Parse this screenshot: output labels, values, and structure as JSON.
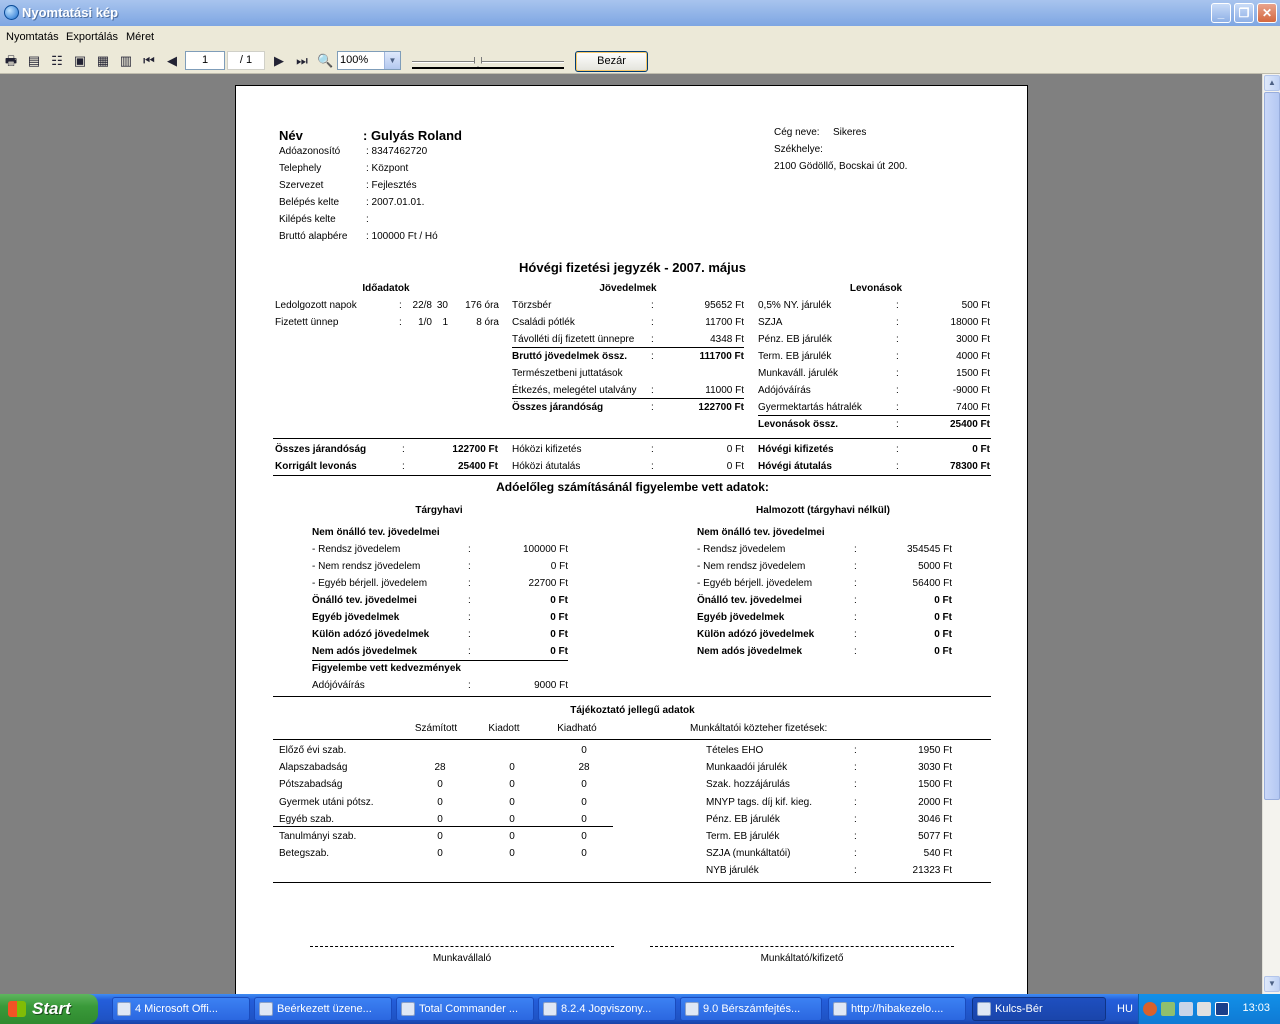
{
  "window": {
    "title": "Nyomtatási kép"
  },
  "menu": [
    "Nyomtatás",
    "Exportálás",
    "Méret"
  ],
  "toolbar": {
    "page_current": "1",
    "page_total": "/ 1",
    "zoom": "100%",
    "close_label": "Bezár"
  },
  "report": {
    "employee": {
      "name_label": "Név",
      "name_value": ": Gulyás Roland",
      "fields": [
        {
          "label": "Adóazonosító",
          "value": ": 8347462720"
        },
        {
          "label": "Telephely",
          "value": ": Központ"
        },
        {
          "label": "Szervezet",
          "value": ": Fejlesztés"
        },
        {
          "label": "Belépés kelte",
          "value": ": 2007.01.01."
        },
        {
          "label": "Kilépés kelte",
          "value": ":"
        },
        {
          "label": "Bruttó alapbére",
          "value": ": 100000  Ft / Hó"
        }
      ]
    },
    "company": {
      "name_label": "Cég neve:",
      "name_value": "Sikeres",
      "seat_label": "Székhelye:",
      "address": "2100  Gödöllő, Bocskai út 200."
    },
    "title": "Hóvégi fizetési jegyzék - 2007. május",
    "time_data": {
      "header": "Időadatok",
      "rows": [
        {
          "label": "Ledolgozott napok",
          "colon": ":",
          "a": "22/8",
          "b": "30",
          "c": "176 óra"
        },
        {
          "label": "Fizetett ünnep",
          "colon": ":",
          "a": "1/0",
          "b": "1",
          "c": "8 óra"
        }
      ]
    },
    "earnings": {
      "header": "Jövedelmek",
      "rows": [
        {
          "label": "Törzsbér",
          "colon": ":",
          "value": "95652  Ft",
          "bold": false
        },
        {
          "label": "Családi pótlék",
          "colon": ":",
          "value": "11700  Ft",
          "bold": false
        },
        {
          "label": "Távolléti díj fizetett ünnepre",
          "colon": ":",
          "value": "4348  Ft",
          "bold": false
        },
        {
          "label": "Bruttó jövedelmek össz.",
          "colon": ":",
          "value": "111700 Ft",
          "bold": true
        },
        {
          "label": "Természetbeni juttatások",
          "colon": "",
          "value": "",
          "bold": false
        },
        {
          "label": "Étkezés, melegétel utalvány",
          "colon": ":",
          "value": "11000  Ft",
          "bold": false
        },
        {
          "label": "Összes járandóság",
          "colon": ":",
          "value": "122700 Ft",
          "bold": true
        }
      ]
    },
    "deductions": {
      "header": "Levonások",
      "rows": [
        {
          "label": "0,5% NY. járulék",
          "colon": ":",
          "value": "500  Ft",
          "bold": false
        },
        {
          "label": "SZJA",
          "colon": ":",
          "value": "18000  Ft",
          "bold": false
        },
        {
          "label": "Pénz. EB járulék",
          "colon": ":",
          "value": "3000  Ft",
          "bold": false
        },
        {
          "label": "Term. EB járulék",
          "colon": ":",
          "value": "4000  Ft",
          "bold": false
        },
        {
          "label": "Munkaváll. járulék",
          "colon": ":",
          "value": "1500  Ft",
          "bold": false
        },
        {
          "label": "Adójóváírás",
          "colon": ":",
          "value": "-9000  Ft",
          "bold": false
        },
        {
          "label": "Gyermektartás hátralék",
          "colon": ":",
          "value": "7400  Ft",
          "bold": false
        },
        {
          "label": "Levonások össz.",
          "colon": ":",
          "value": "25400 Ft",
          "bold": true
        }
      ]
    },
    "summary": {
      "left": [
        {
          "label": "Összes járandóság",
          "colon": ":",
          "value": "122700 Ft"
        },
        {
          "label": "Korrigált levonás",
          "colon": ":",
          "value": "25400 Ft"
        }
      ],
      "mid": [
        {
          "label": "Hóközi kifizetés",
          "colon": ":",
          "value": "0  Ft"
        },
        {
          "label": "Hóközi átutalás",
          "colon": ":",
          "value": "0  Ft"
        }
      ],
      "right": [
        {
          "label": "Hóvégi kifizetés",
          "colon": ":",
          "value": "0 Ft"
        },
        {
          "label": "Hóvégi átutalás",
          "colon": ":",
          "value": "78300 Ft"
        }
      ]
    },
    "tax_section": {
      "title": "Adóelőleg számításánál figyelembe vett adatok:",
      "monthly": {
        "header": "Tárgyhavi",
        "rows": [
          {
            "label": "Nem önálló tev. jövedelmei",
            "colon": "",
            "value": "",
            "bold": true
          },
          {
            "label": "- Rendsz jövedelem",
            "colon": ":",
            "value": "100000  Ft",
            "bold": false
          },
          {
            "label": "- Nem rendsz jövedelem",
            "colon": ":",
            "value": "0  Ft",
            "bold": false
          },
          {
            "label": "- Egyéb bérjell. jövedelem",
            "colon": ":",
            "value": "22700  Ft",
            "bold": false
          },
          {
            "label": "Önálló tev. jövedelmei",
            "colon": ":",
            "value": "0 Ft",
            "bold": true
          },
          {
            "label": "Egyéb jövedelmek",
            "colon": ":",
            "value": "0 Ft",
            "bold": true
          },
          {
            "label": "Külön adózó jövedelmek",
            "colon": ":",
            "value": "0 Ft",
            "bold": true
          },
          {
            "label": "Nem adós jövedelmek",
            "colon": ":",
            "value": "0 Ft",
            "bold": true
          },
          {
            "label": "Figyelembe vett kedvezmények",
            "colon": "",
            "value": "",
            "bold": true
          },
          {
            "label": "Adójóváírás",
            "colon": ":",
            "value": "9000  Ft",
            "bold": false
          }
        ]
      },
      "cumulative": {
        "header": "Halmozott (tárgyhavi nélkül)",
        "rows": [
          {
            "label": "Nem önálló tev. jövedelmei",
            "colon": "",
            "value": "",
            "bold": true
          },
          {
            "label": "- Rendsz jövedelem",
            "colon": ":",
            "value": "354545  Ft",
            "bold": false
          },
          {
            "label": "- Nem rendsz jövedelem",
            "colon": ":",
            "value": "5000  Ft",
            "bold": false
          },
          {
            "label": "- Egyéb bérjell. jövedelem",
            "colon": ":",
            "value": "56400  Ft",
            "bold": false
          },
          {
            "label": "Önálló tev. jövedelmei",
            "colon": ":",
            "value": "0 Ft",
            "bold": true
          },
          {
            "label": "Egyéb jövedelmek",
            "colon": ":",
            "value": "0 Ft",
            "bold": true
          },
          {
            "label": "Külön adózó jövedelmek",
            "colon": ":",
            "value": "0 Ft",
            "bold": true
          },
          {
            "label": "Nem adós jövedelmek",
            "colon": ":",
            "value": "0 Ft",
            "bold": true
          }
        ]
      }
    },
    "info_section": {
      "title": "Tájékoztató jellegű adatok",
      "leave_headers": [
        "Számított",
        "Kiadott",
        "Kiadható"
      ],
      "leave_rows": [
        {
          "label": "Előző évi szab.",
          "a": "",
          "b": "",
          "c": "0"
        },
        {
          "label": "Alapszabadság",
          "a": "28",
          "b": "0",
          "c": "28"
        },
        {
          "label": "Pótszabadság",
          "a": "0",
          "b": "0",
          "c": "0"
        },
        {
          "label": "Gyermek utáni pótsz.",
          "a": "0",
          "b": "0",
          "c": "0"
        },
        {
          "label": "Egyéb szab.",
          "a": "0",
          "b": "0",
          "c": "0"
        },
        {
          "label": "Tanulmányi szab.",
          "a": "0",
          "b": "0",
          "c": "0"
        },
        {
          "label": "Betegszab.",
          "a": "0",
          "b": "0",
          "c": "0"
        }
      ],
      "employer_header": "Munkáltatói közteher fizetések:",
      "employer_rows": [
        {
          "label": "Tételes EHO",
          "colon": ":",
          "value": "1950  Ft"
        },
        {
          "label": "Munkaadói járulék",
          "colon": ":",
          "value": "3030  Ft"
        },
        {
          "label": "Szak. hozzájárulás",
          "colon": ":",
          "value": "1500  Ft"
        },
        {
          "label": "MNYP tags. díj kif. kieg.",
          "colon": ":",
          "value": "2000  Ft"
        },
        {
          "label": "Pénz. EB járulék",
          "colon": ":",
          "value": "3046  Ft"
        },
        {
          "label": "Term. EB járulék",
          "colon": ":",
          "value": "5077  Ft"
        },
        {
          "label": "SZJA (munkáltatói)",
          "colon": ":",
          "value": "540  Ft"
        },
        {
          "label": "NYB járulék",
          "colon": ":",
          "value": "21323  Ft"
        }
      ]
    },
    "signatures": {
      "employee": "Munkavállaló",
      "employer": "Munkáltató/kifizető"
    }
  },
  "taskbar": {
    "start": "Start",
    "tasks": [
      {
        "label": "4 Microsoft Offi...",
        "active": false
      },
      {
        "label": "Beérkezett üzene...",
        "active": false
      },
      {
        "label": "Total Commander ...",
        "active": false
      },
      {
        "label": "8.2.4 Jogviszony...",
        "active": false
      },
      {
        "label": "9.0 Bérszámfejtés...",
        "active": false
      },
      {
        "label": "http://hibakezelo....",
        "active": false
      },
      {
        "label": "Kulcs-Bér",
        "active": true
      }
    ],
    "lang": "HU",
    "clock": "13:03"
  }
}
